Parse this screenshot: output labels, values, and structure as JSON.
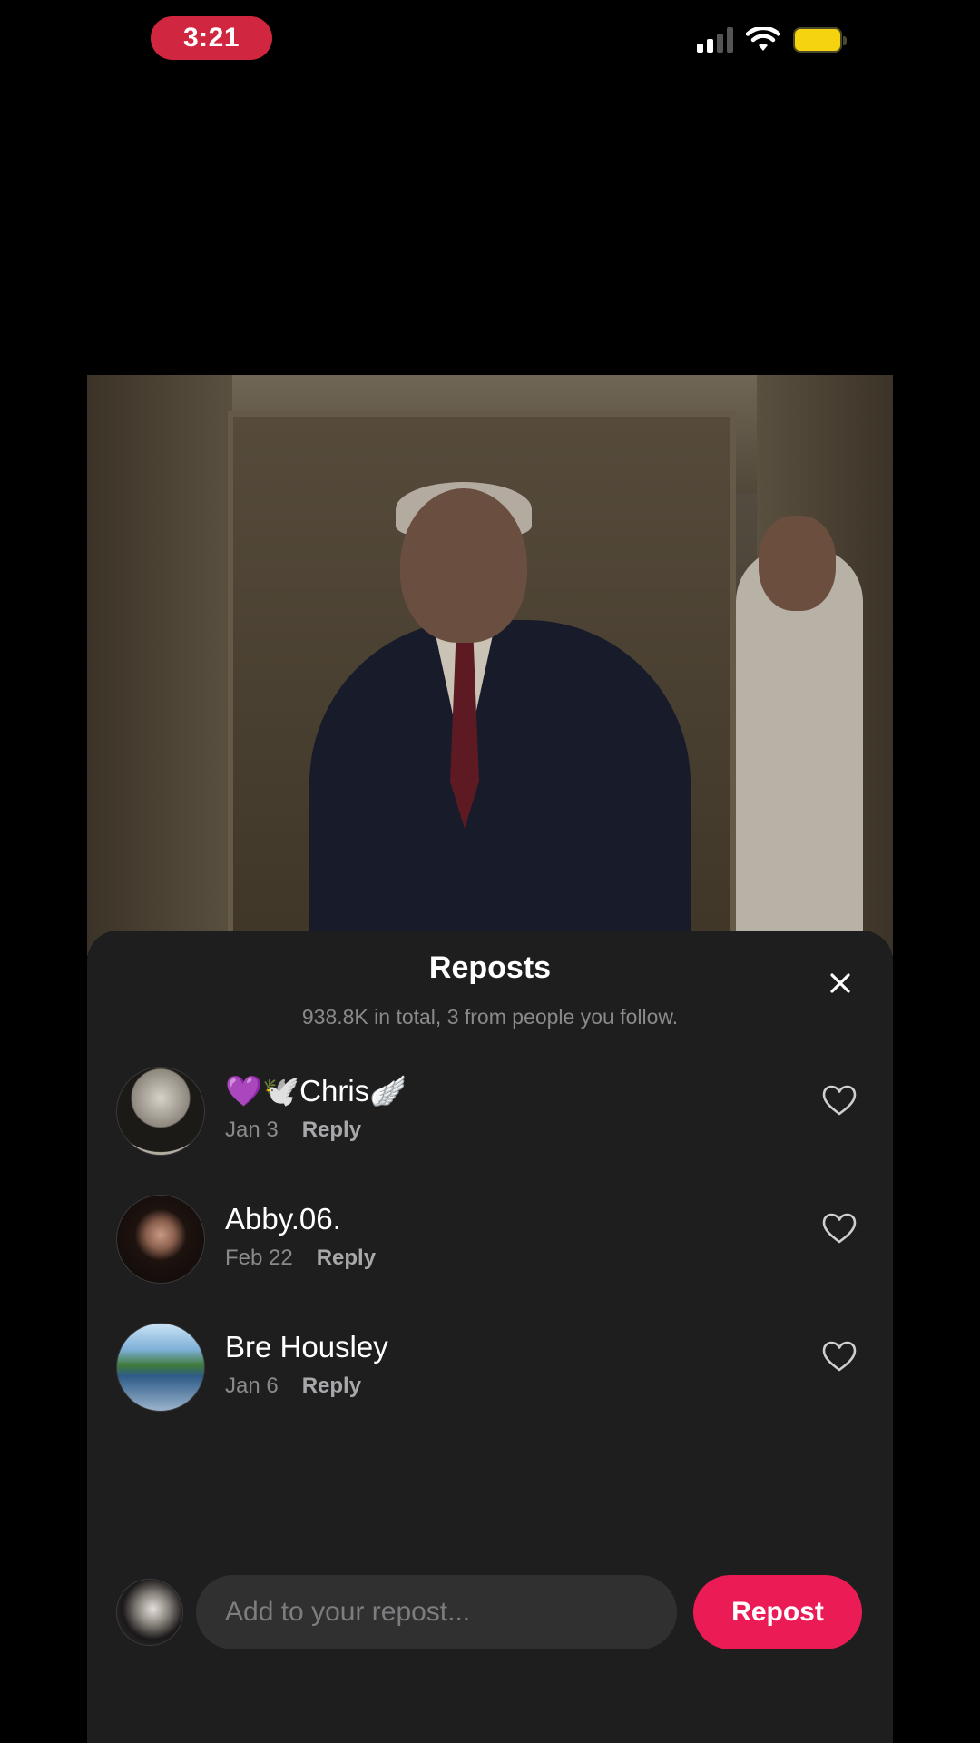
{
  "status_bar": {
    "time": "3:21",
    "signal_bars": 2,
    "battery_color": "#f5d30f",
    "time_pill_color": "#d1263f"
  },
  "sheet": {
    "title": "Reposts",
    "subtitle": "938.8K in total, 3 from people you follow.",
    "close_icon": "close-icon"
  },
  "reposts": [
    {
      "name": "💜🕊️Chris🪽",
      "date": "Jan 3",
      "reply_label": "Reply"
    },
    {
      "name": "Abby.06.",
      "date": "Feb 22",
      "reply_label": "Reply"
    },
    {
      "name": "Bre Housley",
      "date": "Jan 6",
      "reply_label": "Reply"
    }
  ],
  "compose": {
    "placeholder": "Add to your repost...",
    "button_label": "Repost",
    "accent_color": "#eb1b55"
  }
}
